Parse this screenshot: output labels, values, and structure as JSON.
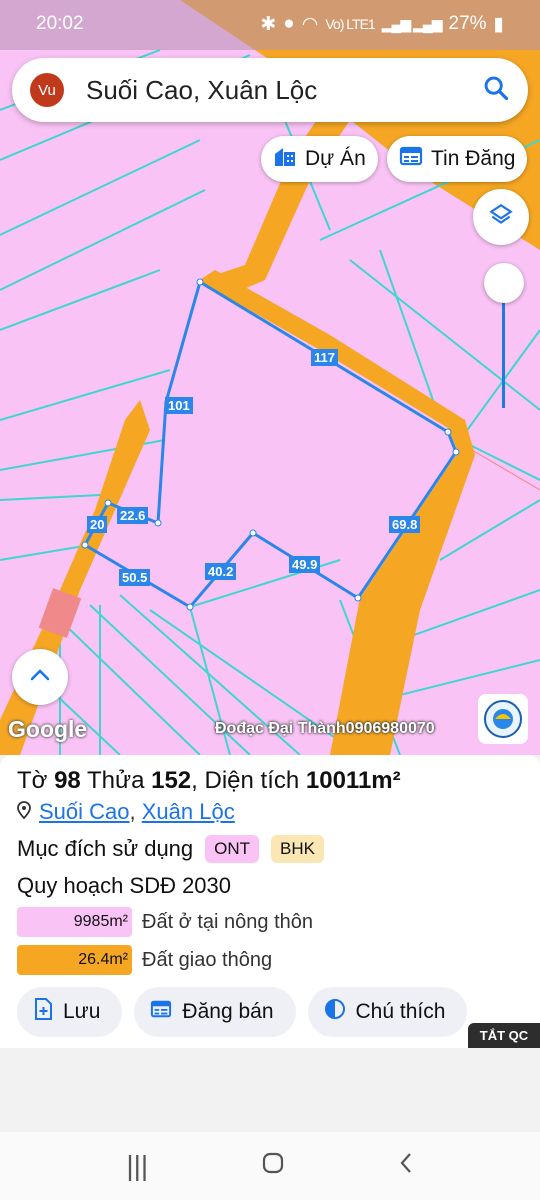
{
  "status_bar": {
    "time": "20:02",
    "volte": "Vo) LTE1",
    "battery": "27%"
  },
  "search": {
    "avatar_text": "Vu",
    "query": "Suối Cao, Xuân Lộc"
  },
  "chips": {
    "du_an": "Dự Án",
    "tin_dang": "Tin Đăng"
  },
  "map": {
    "edge_labels": [
      "117",
      "101",
      "22.6",
      "20",
      "50.5",
      "40.2",
      "49.9",
      "69.8"
    ],
    "google": "Google",
    "watermark": "Đođạc Đại Thành0906980070",
    "colors": {
      "land": "#f9c3f5",
      "road": "#f5a623",
      "boundary": "#2a86e8",
      "grid": "#3fd6d0"
    }
  },
  "parcel": {
    "sheet_label": "Tờ",
    "sheet_no": "98",
    "parcel_label": "Thửa",
    "parcel_no": "152",
    "area_label": ", Diện tích",
    "area": "10011m²",
    "commune": "Suối Cao",
    "district": "Xuân Lộc",
    "purpose_label": "Mục đích sử dụng",
    "purpose_tags": [
      "ONT",
      "BHK"
    ],
    "plan_title": "Quy hoạch SDĐ 2030",
    "legend": [
      {
        "value": "9985m²",
        "label": "Đất ở tại nông thôn",
        "color": "#f9c3f5"
      },
      {
        "value": "26.4m²",
        "label": "Đất giao thông",
        "color": "#f5a623"
      }
    ]
  },
  "actions": {
    "save": "Lưu",
    "post": "Đăng bán",
    "legend": "Chú thích"
  },
  "ads": {
    "close_label": "TẮT QC"
  }
}
